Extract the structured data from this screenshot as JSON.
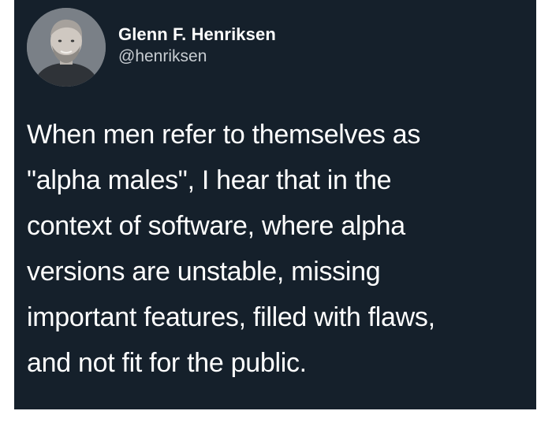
{
  "tweet": {
    "author": {
      "display_name": "Glenn F. Henriksen",
      "handle": "@henriksen",
      "avatar_icon": "user-avatar-photo"
    },
    "lines": [
      "When men refer to themselves as",
      "\"alpha males\", I hear that in the",
      "context of software, where alpha",
      "versions are unstable, missing",
      "important features, filled with flaws,",
      "and not fit for the public."
    ]
  },
  "colors": {
    "card_background": "#15202b",
    "text_primary": "#ffffff",
    "text_secondary": "#c8cdd2",
    "page_background": "#ffffff"
  }
}
